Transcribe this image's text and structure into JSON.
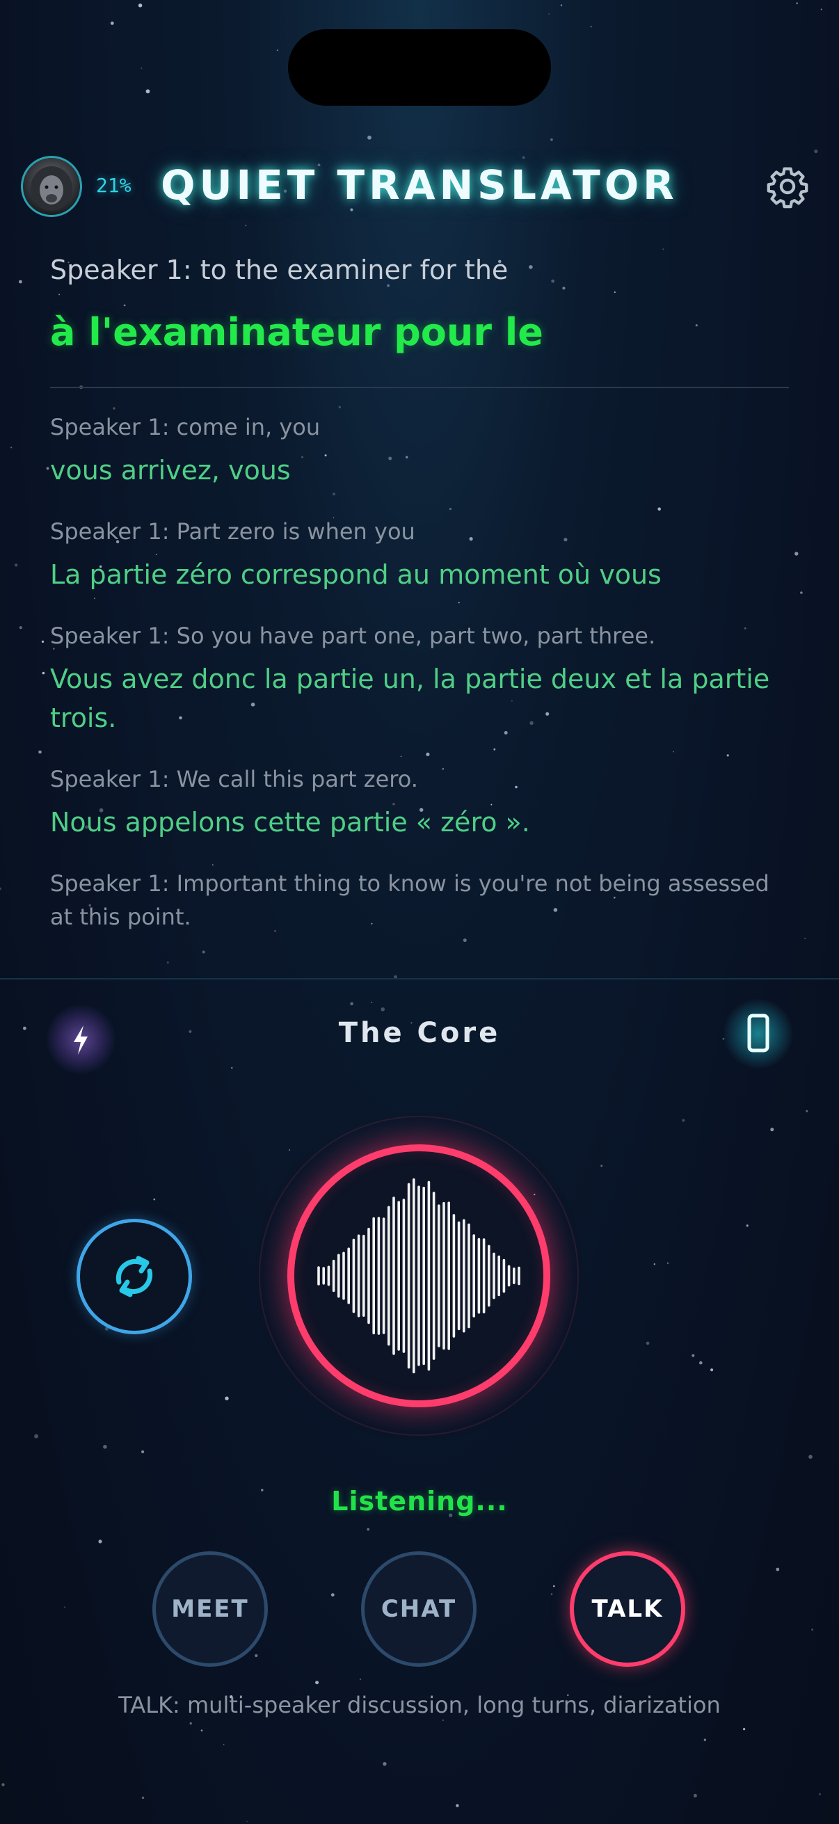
{
  "header": {
    "title": "QUIET TRANSLATOR",
    "battery_percent": "21%",
    "avatar_icon": "lion-avatar",
    "settings_icon": "gear-icon"
  },
  "live": {
    "source": "Speaker 1: to the examiner for the",
    "translation": "à l'examinateur pour le"
  },
  "history": [
    {
      "source": "Speaker 1: come in, you",
      "translation": "vous arrivez, vous"
    },
    {
      "source": "Speaker 1: Part zero is when you",
      "translation": "La partie zéro correspond au moment où vous"
    },
    {
      "source": "Speaker 1: So you have part one, part two, part three.",
      "translation": "Vous avez donc la partie un, la partie deux et la partie trois."
    },
    {
      "source": "Speaker 1: We call this part zero.",
      "translation": "Nous appelons cette partie « zéro »."
    },
    {
      "source": "Speaker 1: Important thing to know is you're not being assessed at this point.",
      "translation": ""
    }
  ],
  "core": {
    "label": "The Core",
    "left_icon": "bolt-icon",
    "right_icon": "phone-icon",
    "swap_icon": "swap-icon",
    "mic_icon": "waveform-icon"
  },
  "status": "Listening...",
  "modes": {
    "meet": "MEET",
    "chat": "CHAT",
    "talk": "TALK",
    "active": "TALK"
  },
  "mode_description": "TALK: multi-speaker discussion, long turns, diarization",
  "colors": {
    "accent_green": "#22ea4a",
    "accent_red": "#ff3d6d",
    "accent_cyan": "#2fd3e6",
    "translation_green": "#4fcf86"
  }
}
